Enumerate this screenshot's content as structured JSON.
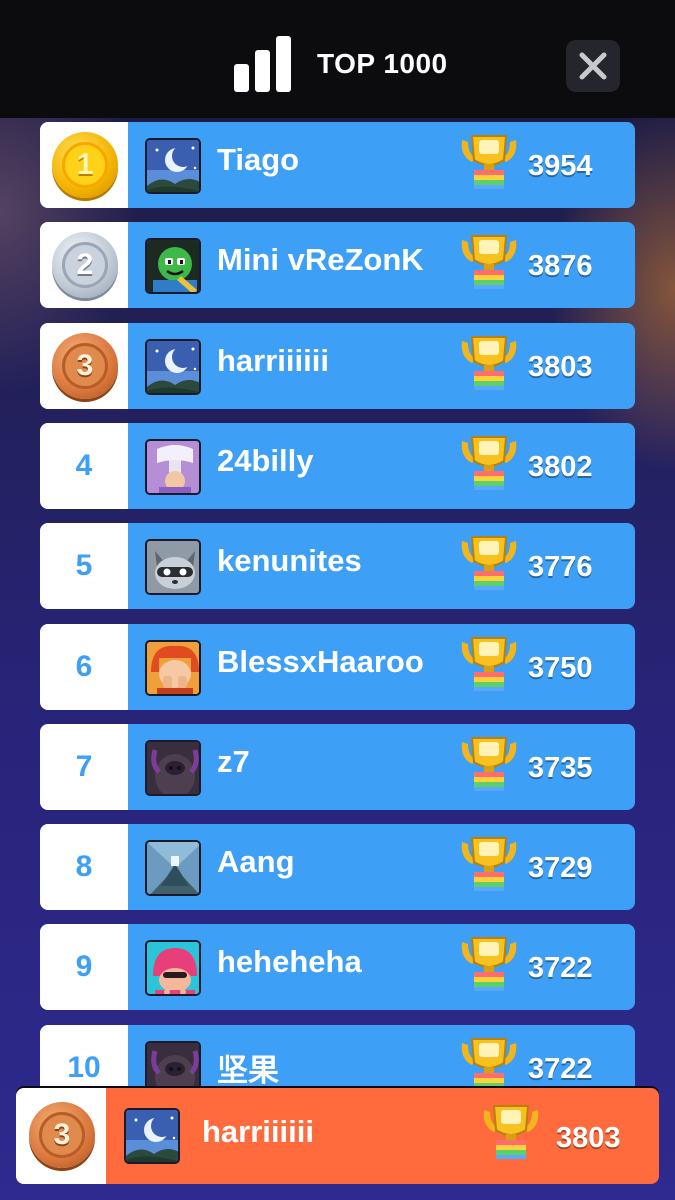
{
  "header": {
    "title": "TOP 1000"
  },
  "colors": {
    "row_bg": "#3d9ff5",
    "player_row_bg": "#ff6b3d",
    "rank_text": "#3d9ff5"
  },
  "leaderboard": [
    {
      "rank": "1",
      "name": "Tiago",
      "score": "3954",
      "medal": "gold",
      "avatar": "night-moon-avatar"
    },
    {
      "rank": "2",
      "name": "Mini vReZonK",
      "score": "3876",
      "medal": "silver",
      "avatar": "green-goblin-avatar"
    },
    {
      "rank": "3",
      "name": "harriiiiii",
      "score": "3803",
      "medal": "bronze",
      "avatar": "night-moon-avatar"
    },
    {
      "rank": "4",
      "name": "24billy",
      "score": "3802",
      "medal": "none",
      "avatar": "axe-princess-avatar"
    },
    {
      "rank": "5",
      "name": "kenunites",
      "score": "3776",
      "medal": "none",
      "avatar": "raccoon-avatar"
    },
    {
      "rank": "6",
      "name": "BlessxHaaroo",
      "score": "3750",
      "medal": "none",
      "avatar": "red-hair-girl-avatar"
    },
    {
      "rank": "7",
      "name": "z7",
      "score": "3735",
      "medal": "none",
      "avatar": "dark-beast-avatar"
    },
    {
      "rank": "8",
      "name": "Aang",
      "score": "3729",
      "medal": "none",
      "avatar": "temple-avatar"
    },
    {
      "rank": "9",
      "name": "heheheha",
      "score": "3722",
      "medal": "none",
      "avatar": "pink-hair-avatar"
    },
    {
      "rank": "10",
      "name": "坚果",
      "score": "3722",
      "medal": "none",
      "avatar": "dark-beast-avatar"
    }
  ],
  "player": {
    "rank": "3",
    "name": "harriiiiii",
    "score": "3803",
    "medal": "bronze",
    "avatar": "night-moon-avatar"
  }
}
